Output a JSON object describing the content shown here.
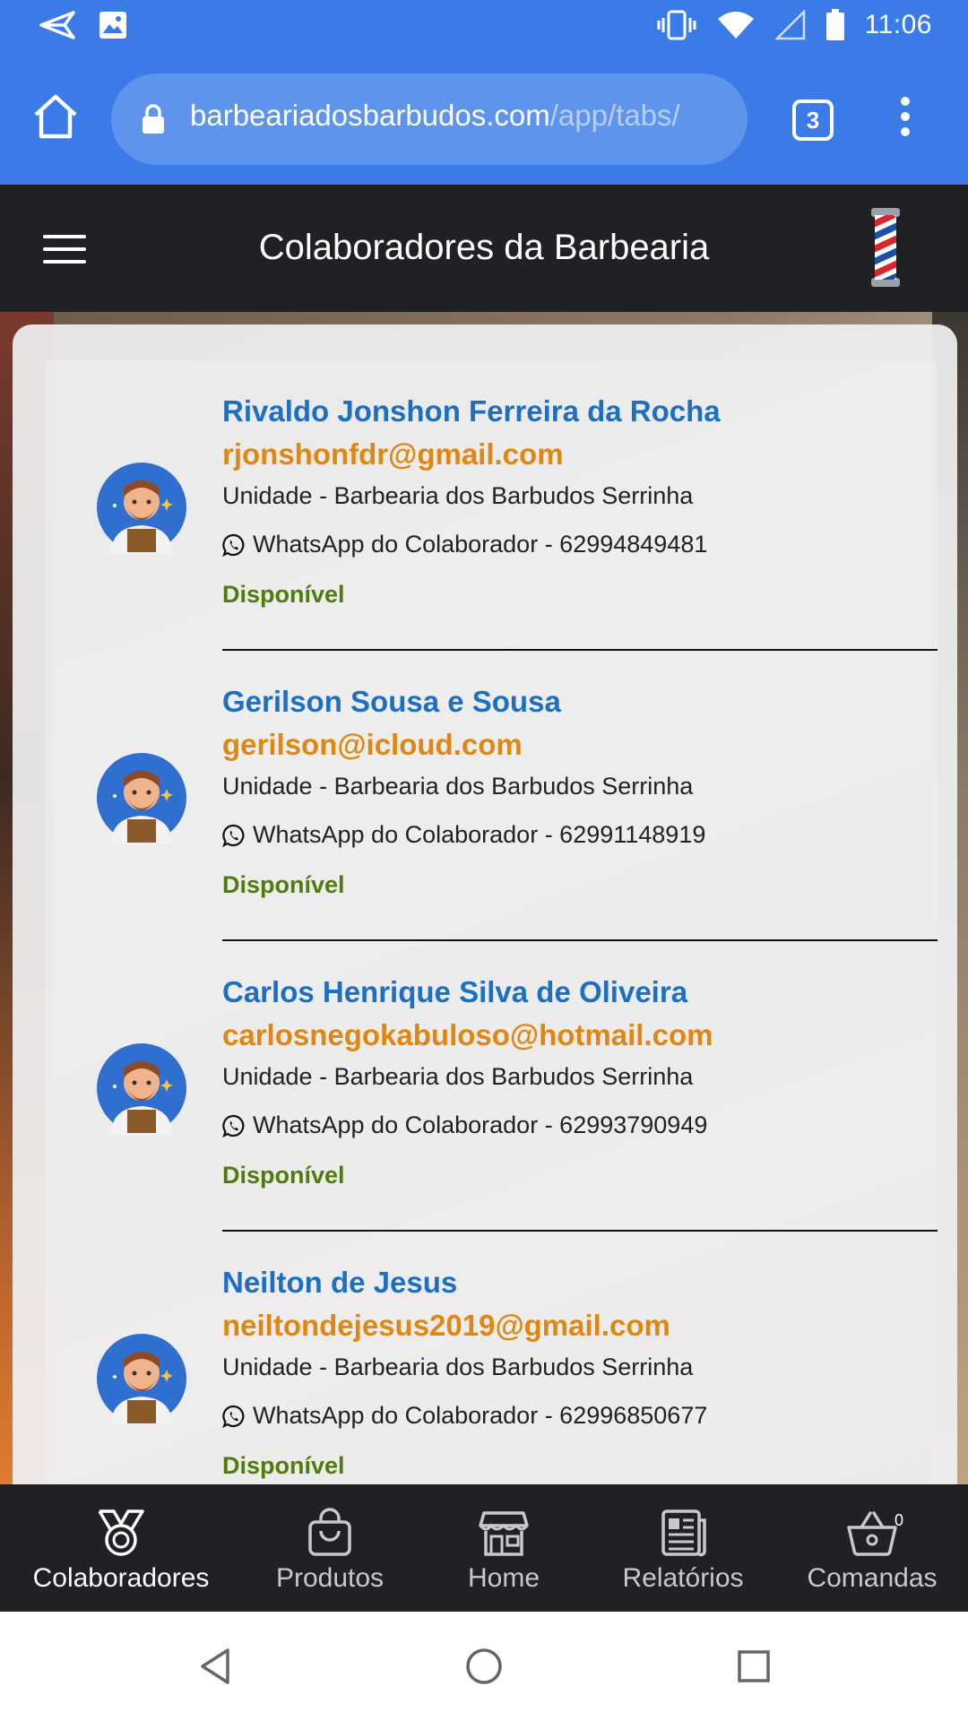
{
  "status_bar": {
    "time": "11:06",
    "left_icons": [
      "send-icon",
      "image-icon"
    ],
    "right_icons": [
      "vibrate-icon",
      "wifi-icon",
      "signal-icon",
      "battery-icon"
    ]
  },
  "browser": {
    "url_domain": "barbeariadosbarbudos.com",
    "url_path": "/app/tabs/",
    "tab_count": "3"
  },
  "header": {
    "title": "Colaboradores da Barbearia"
  },
  "collaborators": [
    {
      "name": "Rivaldo Jonshon Ferreira da Rocha",
      "email": "rjonshonfdr@gmail.com",
      "unit": "Unidade - Barbearia dos Barbudos Serrinha",
      "whatsapp": "WhatsApp do Colaborador - 62994849481",
      "status": "Disponível"
    },
    {
      "name": "Gerilson Sousa e Sousa",
      "email": "gerilson@icloud.com",
      "unit": "Unidade - Barbearia dos Barbudos Serrinha",
      "whatsapp": "WhatsApp do Colaborador - 62991148919",
      "status": "Disponível"
    },
    {
      "name": "Carlos Henrique Silva de Oliveira",
      "email": "carlosnegokabuloso@hotmail.com",
      "unit": "Unidade - Barbearia dos Barbudos Serrinha",
      "whatsapp": "WhatsApp do Colaborador - 62993790949",
      "status": "Disponível"
    },
    {
      "name": "Neilton de Jesus",
      "email": "neiltondejesus2019@gmail.com",
      "unit": "Unidade - Barbearia dos Barbudos Serrinha",
      "whatsapp": "WhatsApp do Colaborador - 62996850677",
      "status": "Disponível"
    }
  ],
  "tabbar": {
    "tabs": [
      {
        "label": "Colaboradores",
        "icon": "medal-icon"
      },
      {
        "label": "Produtos",
        "icon": "shopping-bag-icon"
      },
      {
        "label": "Home",
        "icon": "storefront-icon"
      },
      {
        "label": "Relatórios",
        "icon": "newspaper-icon"
      },
      {
        "label": "Comandas",
        "icon": "basket-icon"
      }
    ],
    "comandas_badge": "0"
  },
  "colors": {
    "primary_blue": "#3b7be8",
    "header_dark": "#1f2125",
    "name_blue": "#1c6fc2",
    "email_orange": "#e08712",
    "status_green": "#4f7d0d"
  }
}
